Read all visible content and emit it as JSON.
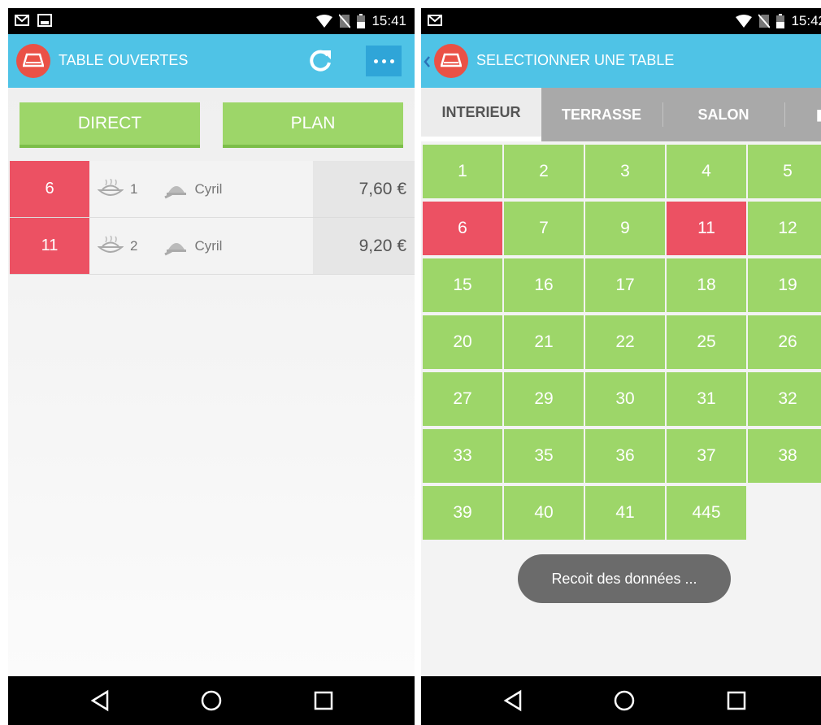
{
  "left": {
    "status_time": "15:41",
    "title": "TABLE OUVERTES",
    "direct_label": "DIRECT",
    "plan_label": "PLAN",
    "orders": [
      {
        "table": "6",
        "covers": "1",
        "waiter": "Cyril",
        "price": "7,60 €"
      },
      {
        "table": "11",
        "covers": "2",
        "waiter": "Cyril",
        "price": "9,20 €"
      }
    ]
  },
  "right": {
    "status_time": "15:42",
    "title": "SELECTIONNER UNE TABLE",
    "tabs": [
      {
        "label": "INTERIEUR",
        "active": true
      },
      {
        "label": "TERRASSE",
        "active": false
      },
      {
        "label": "SALON",
        "active": false
      }
    ],
    "tables": [
      {
        "n": "1",
        "occupied": false
      },
      {
        "n": "2",
        "occupied": false
      },
      {
        "n": "3",
        "occupied": false
      },
      {
        "n": "4",
        "occupied": false
      },
      {
        "n": "5",
        "occupied": false
      },
      {
        "n": "6",
        "occupied": true
      },
      {
        "n": "7",
        "occupied": false
      },
      {
        "n": "9",
        "occupied": false
      },
      {
        "n": "11",
        "occupied": true
      },
      {
        "n": "12",
        "occupied": false
      },
      {
        "n": "15",
        "occupied": false
      },
      {
        "n": "16",
        "occupied": false
      },
      {
        "n": "17",
        "occupied": false
      },
      {
        "n": "18",
        "occupied": false
      },
      {
        "n": "19",
        "occupied": false
      },
      {
        "n": "20",
        "occupied": false
      },
      {
        "n": "21",
        "occupied": false
      },
      {
        "n": "22",
        "occupied": false
      },
      {
        "n": "25",
        "occupied": false
      },
      {
        "n": "26",
        "occupied": false
      },
      {
        "n": "27",
        "occupied": false
      },
      {
        "n": "29",
        "occupied": false
      },
      {
        "n": "30",
        "occupied": false
      },
      {
        "n": "31",
        "occupied": false
      },
      {
        "n": "32",
        "occupied": false
      },
      {
        "n": "33",
        "occupied": false
      },
      {
        "n": "35",
        "occupied": false
      },
      {
        "n": "36",
        "occupied": false
      },
      {
        "n": "37",
        "occupied": false
      },
      {
        "n": "38",
        "occupied": false
      },
      {
        "n": "39",
        "occupied": false
      },
      {
        "n": "40",
        "occupied": false
      },
      {
        "n": "41",
        "occupied": false
      },
      {
        "n": "445",
        "occupied": false
      }
    ],
    "toast": "Recoit des données ..."
  },
  "colors": {
    "appbar": "#4fc3e6",
    "free_table": "#9dd669",
    "occupied_table": "#ec5163",
    "logo": "#ea5146",
    "more_button": "#2fa5d8"
  },
  "icons": {
    "status_left": [
      "gmail-icon",
      "image-icon"
    ],
    "status_right": [
      "wifi-icon",
      "no-sim-icon",
      "battery-icon"
    ],
    "order_row": [
      "plate-icon",
      "cloche-icon"
    ],
    "appbar": [
      "tablet-logo-icon",
      "refresh-icon",
      "more-dots-icon",
      "back-chevron-icon"
    ],
    "navbar": [
      "back-nav-icon",
      "home-nav-icon",
      "recents-nav-icon"
    ]
  }
}
